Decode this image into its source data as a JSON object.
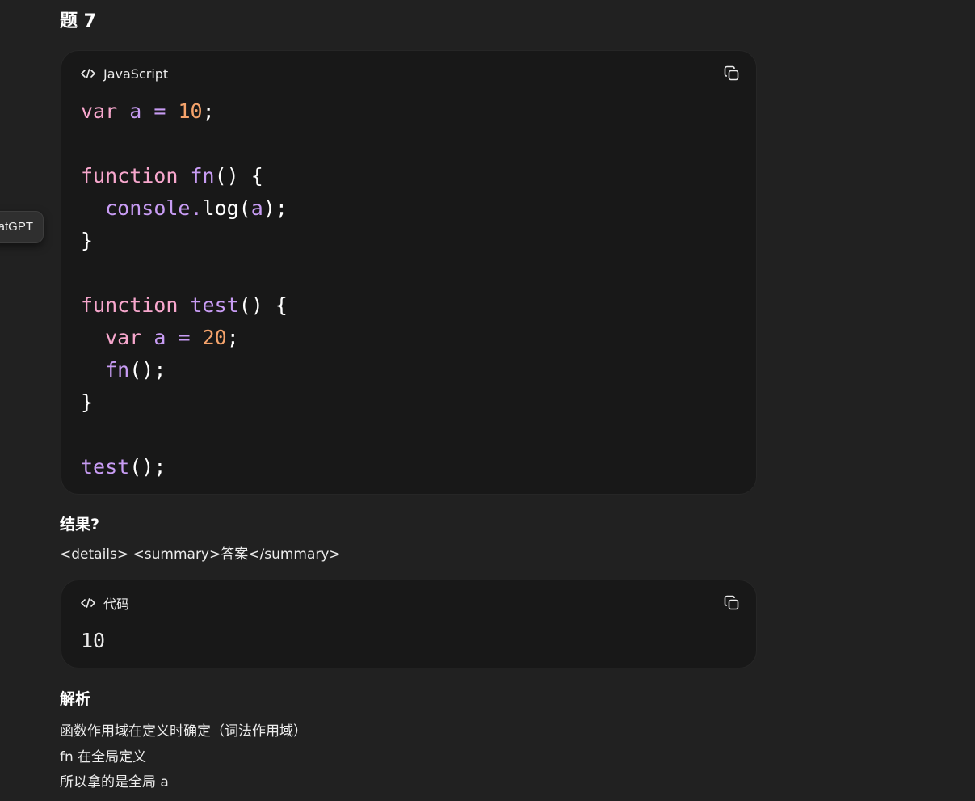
{
  "question_title": "题 7",
  "tooltip_text": "atGPT",
  "code_block": {
    "language": "JavaScript",
    "copy_icon": "copy-icon",
    "lines": [
      [
        {
          "t": "var",
          "c": "kw"
        },
        {
          "t": " ",
          "c": "pl"
        },
        {
          "t": "a",
          "c": "var"
        },
        {
          "t": " ",
          "c": "pl"
        },
        {
          "t": "=",
          "c": "op"
        },
        {
          "t": " ",
          "c": "pl"
        },
        {
          "t": "10",
          "c": "num"
        },
        {
          "t": ";",
          "c": "pl"
        }
      ],
      [],
      [
        {
          "t": "function",
          "c": "kw"
        },
        {
          "t": " ",
          "c": "pl"
        },
        {
          "t": "fn",
          "c": "fn"
        },
        {
          "t": "() {",
          "c": "pl"
        }
      ],
      [
        {
          "t": "  ",
          "c": "pl"
        },
        {
          "t": "console.",
          "c": "fn"
        },
        {
          "t": "log(",
          "c": "pl"
        },
        {
          "t": "a",
          "c": "var"
        },
        {
          "t": ");",
          "c": "pl"
        }
      ],
      [
        {
          "t": "}",
          "c": "pl"
        }
      ],
      [],
      [
        {
          "t": "function",
          "c": "kw"
        },
        {
          "t": " ",
          "c": "pl"
        },
        {
          "t": "test",
          "c": "fn"
        },
        {
          "t": "() {",
          "c": "pl"
        }
      ],
      [
        {
          "t": "  ",
          "c": "pl"
        },
        {
          "t": "var",
          "c": "kw"
        },
        {
          "t": " ",
          "c": "pl"
        },
        {
          "t": "a",
          "c": "var"
        },
        {
          "t": " ",
          "c": "pl"
        },
        {
          "t": "=",
          "c": "op"
        },
        {
          "t": " ",
          "c": "pl"
        },
        {
          "t": "20",
          "c": "num"
        },
        {
          "t": ";",
          "c": "pl"
        }
      ],
      [
        {
          "t": "  ",
          "c": "pl"
        },
        {
          "t": "fn",
          "c": "fn"
        },
        {
          "t": "();",
          "c": "pl"
        }
      ],
      [
        {
          "t": "}",
          "c": "pl"
        }
      ],
      [],
      [
        {
          "t": "test",
          "c": "fn"
        },
        {
          "t": "();",
          "c": "pl"
        }
      ]
    ]
  },
  "result_label": "结果?",
  "details_text": "<details> <summary>答案</summary>",
  "answer_block": {
    "language": "代码",
    "copy_icon": "copy-icon",
    "output": "10"
  },
  "analysis_label": "解析",
  "analysis_lines": [
    "函数作用域在定义时确定（词法作用域）",
    "fn 在全局定义",
    "所以拿的是全局 a"
  ],
  "colors": {
    "background": "#212121",
    "code_background": "#181818",
    "keyword": "#f7a7cd",
    "function": "#c89cf4",
    "number": "#f5a36b"
  }
}
